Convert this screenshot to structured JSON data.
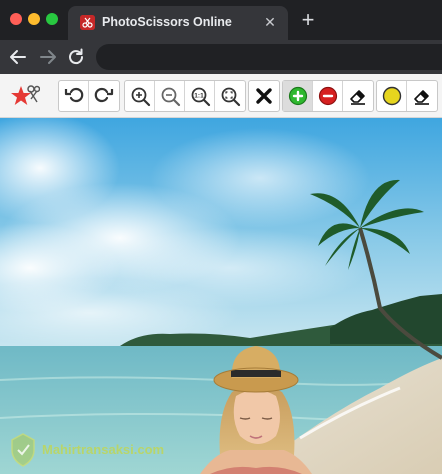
{
  "window": {
    "traffic_lights": {
      "close": "#ff5f57",
      "minimize": "#febc2e",
      "zoom": "#28c840"
    }
  },
  "tab": {
    "title": "PhotoScissors Online",
    "close_glyph": "✕",
    "favicon": "photoscissors-icon"
  },
  "new_tab_glyph": "+",
  "nav": {
    "back_icon": "arrow-left-icon",
    "forward_icon": "arrow-right-icon",
    "reload_icon": "reload-icon",
    "address": ""
  },
  "toolbar": {
    "logo": "photoscissors-logo",
    "groups": [
      {
        "items": [
          "undo-icon",
          "redo-icon"
        ]
      },
      {
        "items": [
          "zoom-in-icon",
          "zoom-out-icon",
          "zoom-actual-size-icon",
          "zoom-fit-icon"
        ]
      },
      {
        "items": [
          "clear-marks-icon"
        ]
      },
      {
        "items": [
          "foreground-marker-icon",
          "background-marker-icon",
          "eraser-icon"
        ]
      },
      {
        "items": [
          "hair-marker-icon",
          "eraser-icon"
        ]
      }
    ],
    "active_tool": "foreground-marker-icon",
    "zoom_actual_label": "1:1",
    "colors": {
      "foreground_marker": "#2eb82e",
      "background_marker": "#d62020",
      "hair_marker": "#e6d51e"
    }
  },
  "canvas": {
    "image": "beach-photo-woman-in-straw-hat"
  },
  "watermark": {
    "text": "Mahirtransaksi.com"
  }
}
